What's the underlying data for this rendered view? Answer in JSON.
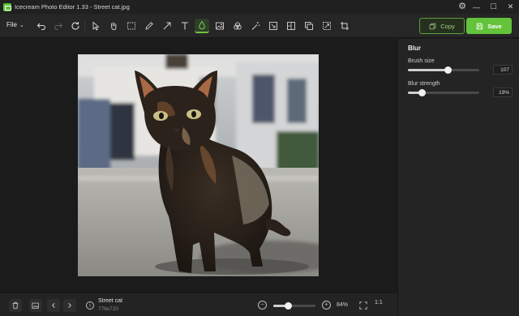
{
  "app": {
    "title": "Icecream Photo Editor 1.33 - Street cat.jpg"
  },
  "toolbar": {
    "file_label": "File",
    "copy_label": "Copy",
    "save_label": "Save",
    "accent": "#63c33b",
    "active_tool": "blur-tool"
  },
  "panel": {
    "title": "Blur",
    "brush_size": {
      "label": "Brush size",
      "value": "107",
      "level": 0.56
    },
    "blur_strength": {
      "label": "Blur strength",
      "value": "19%",
      "level": 0.19
    }
  },
  "footer": {
    "file_name": "Street cat",
    "file_dims": "776x720",
    "zoom_value": "84%",
    "zoom_level": 0.35,
    "ratio_label": "1:1"
  }
}
